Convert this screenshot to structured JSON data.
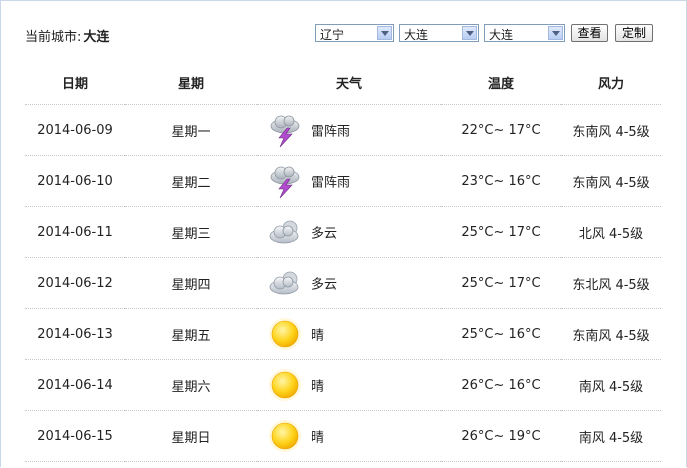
{
  "header": {
    "city_label": "当前城市:",
    "city_name": "大连"
  },
  "selectors": {
    "province": "辽宁",
    "city": "大连",
    "district": "大连"
  },
  "buttons": {
    "view": "查看",
    "customize": "定制"
  },
  "table": {
    "columns": [
      "日期",
      "星期",
      "天气",
      "温度",
      "风力"
    ],
    "rows": [
      {
        "date": "2014-06-09",
        "weekday": "星期一",
        "icon": "thunderstorm-icon",
        "weather": "雷阵雨",
        "temp": "22°C~ 17°C",
        "wind": "东南风 4-5级"
      },
      {
        "date": "2014-06-10",
        "weekday": "星期二",
        "icon": "thunderstorm-icon",
        "weather": "雷阵雨",
        "temp": "23°C~ 16°C",
        "wind": "东南风 4-5级"
      },
      {
        "date": "2014-06-11",
        "weekday": "星期三",
        "icon": "cloudy-icon",
        "weather": "多云",
        "temp": "25°C~ 17°C",
        "wind": "北风 4-5级"
      },
      {
        "date": "2014-06-12",
        "weekday": "星期四",
        "icon": "cloudy-icon",
        "weather": "多云",
        "temp": "25°C~ 17°C",
        "wind": "东北风 4-5级"
      },
      {
        "date": "2014-06-13",
        "weekday": "星期五",
        "icon": "sunny-icon",
        "weather": "晴",
        "temp": "25°C~ 16°C",
        "wind": "东南风 4-5级"
      },
      {
        "date": "2014-06-14",
        "weekday": "星期六",
        "icon": "sunny-icon",
        "weather": "晴",
        "temp": "26°C~ 16°C",
        "wind": "南风 4-5级"
      },
      {
        "date": "2014-06-15",
        "weekday": "星期日",
        "icon": "sunny-icon",
        "weather": "晴",
        "temp": "26°C~ 19°C",
        "wind": "南风 4-5级"
      }
    ]
  }
}
